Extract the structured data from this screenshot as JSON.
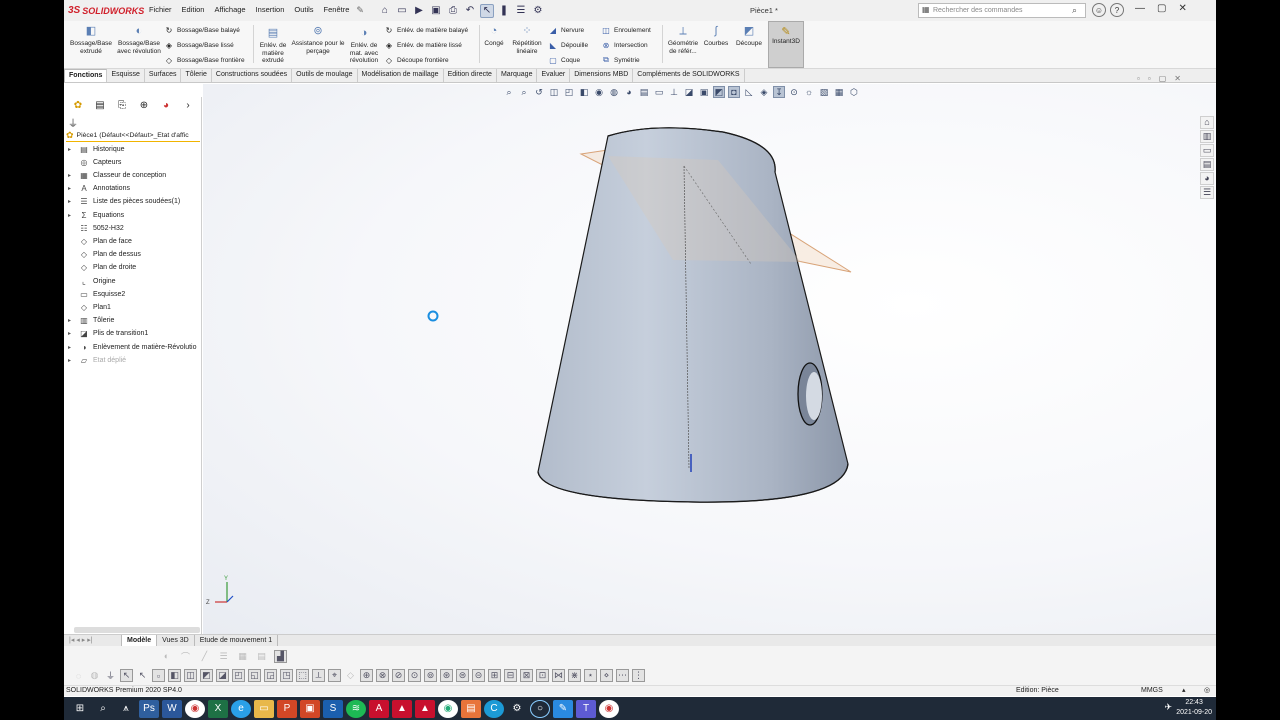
{
  "app": {
    "logo_text": "SOLIDWORKS",
    "document_title": "Pièce1 *",
    "menu": [
      "Fichier",
      "Edition",
      "Affichage",
      "Insertion",
      "Outils",
      "Fenêtre"
    ],
    "search_placeholder": "Rechercher des commandes"
  },
  "ribbon": {
    "big_buttons": [
      {
        "label": "Bossage/Base extrudé",
        "icon": "extruded-boss-icon"
      },
      {
        "label": "Bossage/Base avec révolution",
        "icon": "revolved-boss-icon"
      },
      {
        "label": "Enlév. de matière extrudé",
        "icon": "extruded-cut-icon"
      },
      {
        "label": "Assistance pour le perçage",
        "icon": "hole-wizard-icon"
      },
      {
        "label": "Enlév. de mat. avec révolution",
        "icon": "revolved-cut-icon"
      },
      {
        "label": "Congé",
        "icon": "fillet-icon"
      },
      {
        "label": "Répétition linéaire",
        "icon": "linear-pattern-icon"
      },
      {
        "label": "Géométrie de référ...",
        "icon": "reference-geometry-icon"
      },
      {
        "label": "Courbes",
        "icon": "curves-icon"
      },
      {
        "label": "Découpe",
        "icon": "split-icon"
      },
      {
        "label": "Instant3D",
        "icon": "instant3d-icon"
      }
    ],
    "small_buttons": {
      "boss_group": [
        "Bossage/Base balayé",
        "Bossage/Base lissé",
        "Bossage/Base frontière"
      ],
      "cut_group": [
        "Enlév. de matière balayé",
        "Enlév. de matière lissé",
        "Découpe frontière"
      ],
      "feature_group": [
        "Nervure",
        "Dépouille",
        "Coque"
      ],
      "extra_group": [
        "Enroulement",
        "Intersection",
        "Symétrie"
      ]
    }
  },
  "tabs": [
    "Fonctions",
    "Esquisse",
    "Surfaces",
    "Tôlerie",
    "Constructions soudées",
    "Outils de moulage",
    "Modélisation de maillage",
    "Edition directe",
    "Marquage",
    "Evaluer",
    "Dimensions MBD",
    "Compléments de SOLIDWORKS"
  ],
  "tree": {
    "root": "Pièce1  (Défaut<<Défaut>_Etat d'affic",
    "items": [
      {
        "label": "Historique",
        "expandable": true,
        "icon": "history-icon",
        "dim": false
      },
      {
        "label": "Capteurs",
        "expandable": false,
        "icon": "sensor-icon",
        "dim": false
      },
      {
        "label": "Classeur de conception",
        "expandable": true,
        "icon": "design-binder-icon",
        "dim": false
      },
      {
        "label": "Annotations",
        "expandable": true,
        "icon": "annotation-icon",
        "dim": false
      },
      {
        "label": "Liste des pièces soudées(1)",
        "expandable": true,
        "icon": "cut-list-icon",
        "dim": false
      },
      {
        "label": "Equations",
        "expandable": true,
        "icon": "equation-icon",
        "dim": false
      },
      {
        "label": "5052-H32",
        "expandable": false,
        "icon": "material-icon",
        "dim": false
      },
      {
        "label": "Plan de face",
        "expandable": false,
        "icon": "plane-icon",
        "dim": false
      },
      {
        "label": "Plan de dessus",
        "expandable": false,
        "icon": "plane-icon",
        "dim": false
      },
      {
        "label": "Plan de droite",
        "expandable": false,
        "icon": "plane-icon",
        "dim": false
      },
      {
        "label": "Origine",
        "expandable": false,
        "icon": "origin-icon",
        "dim": false
      },
      {
        "label": "Esquisse2",
        "expandable": false,
        "icon": "sketch-icon",
        "dim": false
      },
      {
        "label": "Plan1",
        "expandable": false,
        "icon": "plane-icon",
        "dim": false
      },
      {
        "label": "Tôlerie",
        "expandable": true,
        "icon": "sheet-metal-icon",
        "dim": false
      },
      {
        "label": "Plis de transition1",
        "expandable": true,
        "icon": "lofted-bend-icon",
        "dim": false
      },
      {
        "label": "Enlèvement de matière-Révolutio",
        "expandable": true,
        "icon": "revolve-cut-icon",
        "dim": false
      },
      {
        "label": "Etat déplié",
        "expandable": true,
        "icon": "flat-pattern-icon",
        "dim": true
      }
    ]
  },
  "model_tabs": [
    "Modèle",
    "Vues 3D",
    "Etude de mouvement 1"
  ],
  "status": {
    "left": "SOLIDWORKS Premium 2020 SP4.0",
    "mode": "Edition: Pièce",
    "units": "MMGS"
  },
  "clock": {
    "time": "22:43",
    "date": "2021-09-20"
  },
  "colors": {
    "brand": "#d01f2a",
    "tree_root_underline": "#f1b400",
    "model_fill": "#b8c2d1"
  }
}
